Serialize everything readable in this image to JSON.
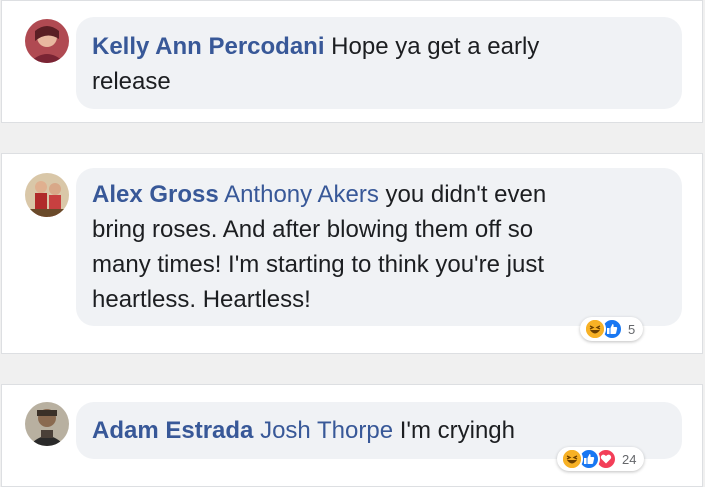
{
  "comments": [
    {
      "author": "Kelly Ann Percodani",
      "mention": "",
      "text_line1": " Hope ya get a early",
      "text_line2": "release",
      "reaction_count": ""
    },
    {
      "author": "Alex Gross",
      "mention": "Anthony Akers",
      "text_line1": " you didn't even",
      "text_line2": "bring roses. And after blowing them off so",
      "text_line3": "many times! I'm starting to think you're just",
      "text_line4": "heartless. Heartless!",
      "reaction_icons": [
        "haha-icon",
        "like-icon"
      ],
      "reaction_count": "5"
    },
    {
      "author": "Adam Estrada",
      "mention": "Josh Thorpe",
      "text_line1": " I'm cryingh",
      "reaction_icons": [
        "haha-icon",
        "like-icon",
        "love-icon"
      ],
      "reaction_count": "24"
    }
  ],
  "colors": {
    "author": "#385898",
    "bubble": "#f0f2f5",
    "like": "#1877f2",
    "love": "#f33e58",
    "haha": "#f7b125"
  }
}
